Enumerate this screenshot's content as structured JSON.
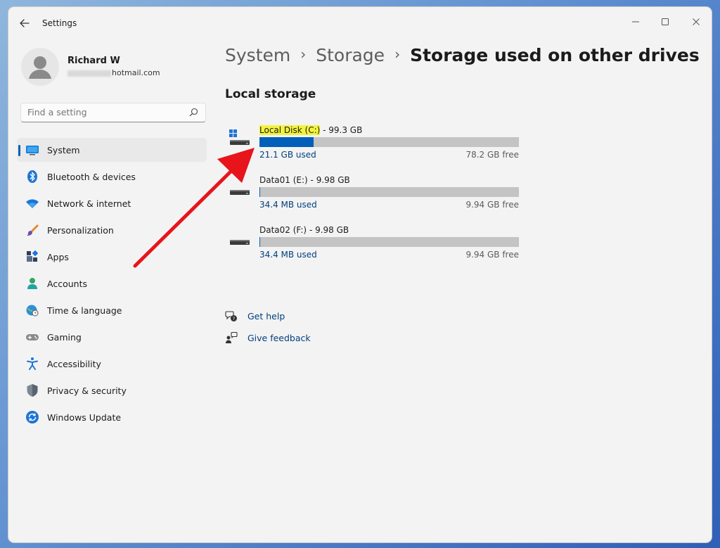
{
  "window": {
    "title": "Settings"
  },
  "user": {
    "name": "Richard W",
    "email_visible": "hotmail.com"
  },
  "search": {
    "placeholder": "Find a setting"
  },
  "nav": {
    "items": [
      {
        "label": "System",
        "icon": "system-monitor-icon",
        "active": true
      },
      {
        "label": "Bluetooth & devices",
        "icon": "bluetooth-icon"
      },
      {
        "label": "Network & internet",
        "icon": "wifi-icon"
      },
      {
        "label": "Personalization",
        "icon": "paintbrush-icon"
      },
      {
        "label": "Apps",
        "icon": "apps-icon"
      },
      {
        "label": "Accounts",
        "icon": "accounts-icon"
      },
      {
        "label": "Time & language",
        "icon": "globe-clock-icon"
      },
      {
        "label": "Gaming",
        "icon": "gamepad-icon"
      },
      {
        "label": "Accessibility",
        "icon": "accessibility-icon"
      },
      {
        "label": "Privacy & security",
        "icon": "shield-icon"
      },
      {
        "label": "Windows Update",
        "icon": "windows-update-icon"
      }
    ]
  },
  "breadcrumb": {
    "items": [
      "System",
      "Storage"
    ],
    "current": "Storage used on other drives",
    "separator": "›"
  },
  "section": {
    "title": "Local storage"
  },
  "drives": [
    {
      "name": "Local Disk (C:)",
      "size": " - 99.3 GB",
      "used": "21.1 GB used",
      "free": "78.2 GB free",
      "used_fraction": 0.21,
      "icon": "windows-drive-icon"
    },
    {
      "name": "Data01 (E:)",
      "size": " - 9.98 GB",
      "used": "34.4 MB used",
      "free": "9.94 GB free",
      "used_fraction": 0.003,
      "icon": "drive-icon"
    },
    {
      "name": "Data02 (F:)",
      "size": " - 9.98 GB",
      "used": "34.4 MB used",
      "free": "9.94 GB free",
      "used_fraction": 0.003,
      "icon": "drive-icon"
    }
  ],
  "help": {
    "get_help": "Get help",
    "give_feedback": "Give feedback"
  },
  "colors": {
    "accent": "#005fb8",
    "highlight": "#f3f33d",
    "annotation_arrow": "#e8141b",
    "bar_track": "#c4c4c4"
  }
}
